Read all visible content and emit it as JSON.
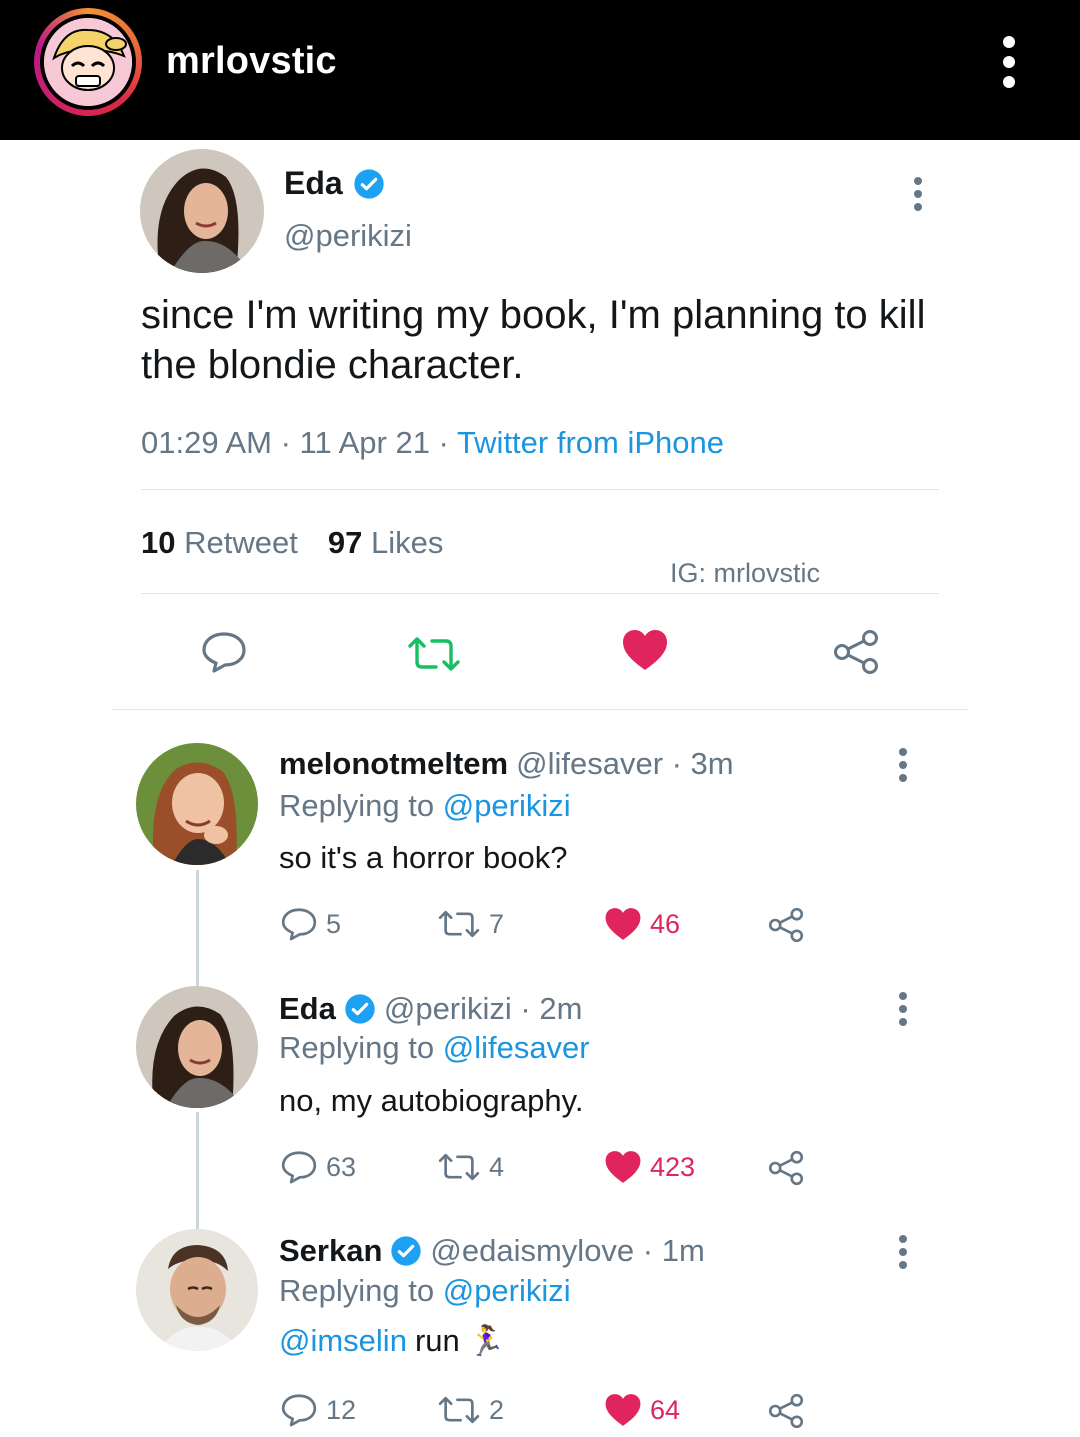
{
  "header": {
    "username": "mrlovstic"
  },
  "tweet": {
    "name": "Eda",
    "handle": "@perikizi",
    "text": "since I'm writing my book, I'm planning to kill the blondie character.",
    "time": "01:29 AM · 11 Apr 21 · ",
    "source": "Twitter from iPhone",
    "retweet_count": "10",
    "retweet_label": "Retweet",
    "likes_count": "97",
    "likes_label": "Likes",
    "watermark": "IG: mrlovstic"
  },
  "replies": [
    {
      "name": "melonotmeltem",
      "handle": "@lifesaver · 3m",
      "replying_prefix": "Replying to ",
      "replying_to": "@perikizi",
      "text": "so it's a horror book?",
      "comments": "5",
      "retweets": "7",
      "likes": "46"
    },
    {
      "name": "Eda",
      "handle": "@perikizi · 2m",
      "replying_prefix": "Replying to ",
      "replying_to": "@lifesaver",
      "text": "no, my autobiography.",
      "comments": "63",
      "retweets": "4",
      "likes": "423"
    },
    {
      "name": "Serkan",
      "handle": "@edaismylove · 1m",
      "replying_prefix": "Replying to ",
      "replying_to": "@perikizi",
      "mention": "@imselin",
      "text": "run",
      "emoji": "🏃‍♀️",
      "comments": "12",
      "retweets": "2",
      "likes": "64"
    }
  ],
  "colors": {
    "twitter_blue": "#1b95e0",
    "like_red": "#e0245e",
    "retweet_green": "#17bf63",
    "gray": "#657786"
  }
}
